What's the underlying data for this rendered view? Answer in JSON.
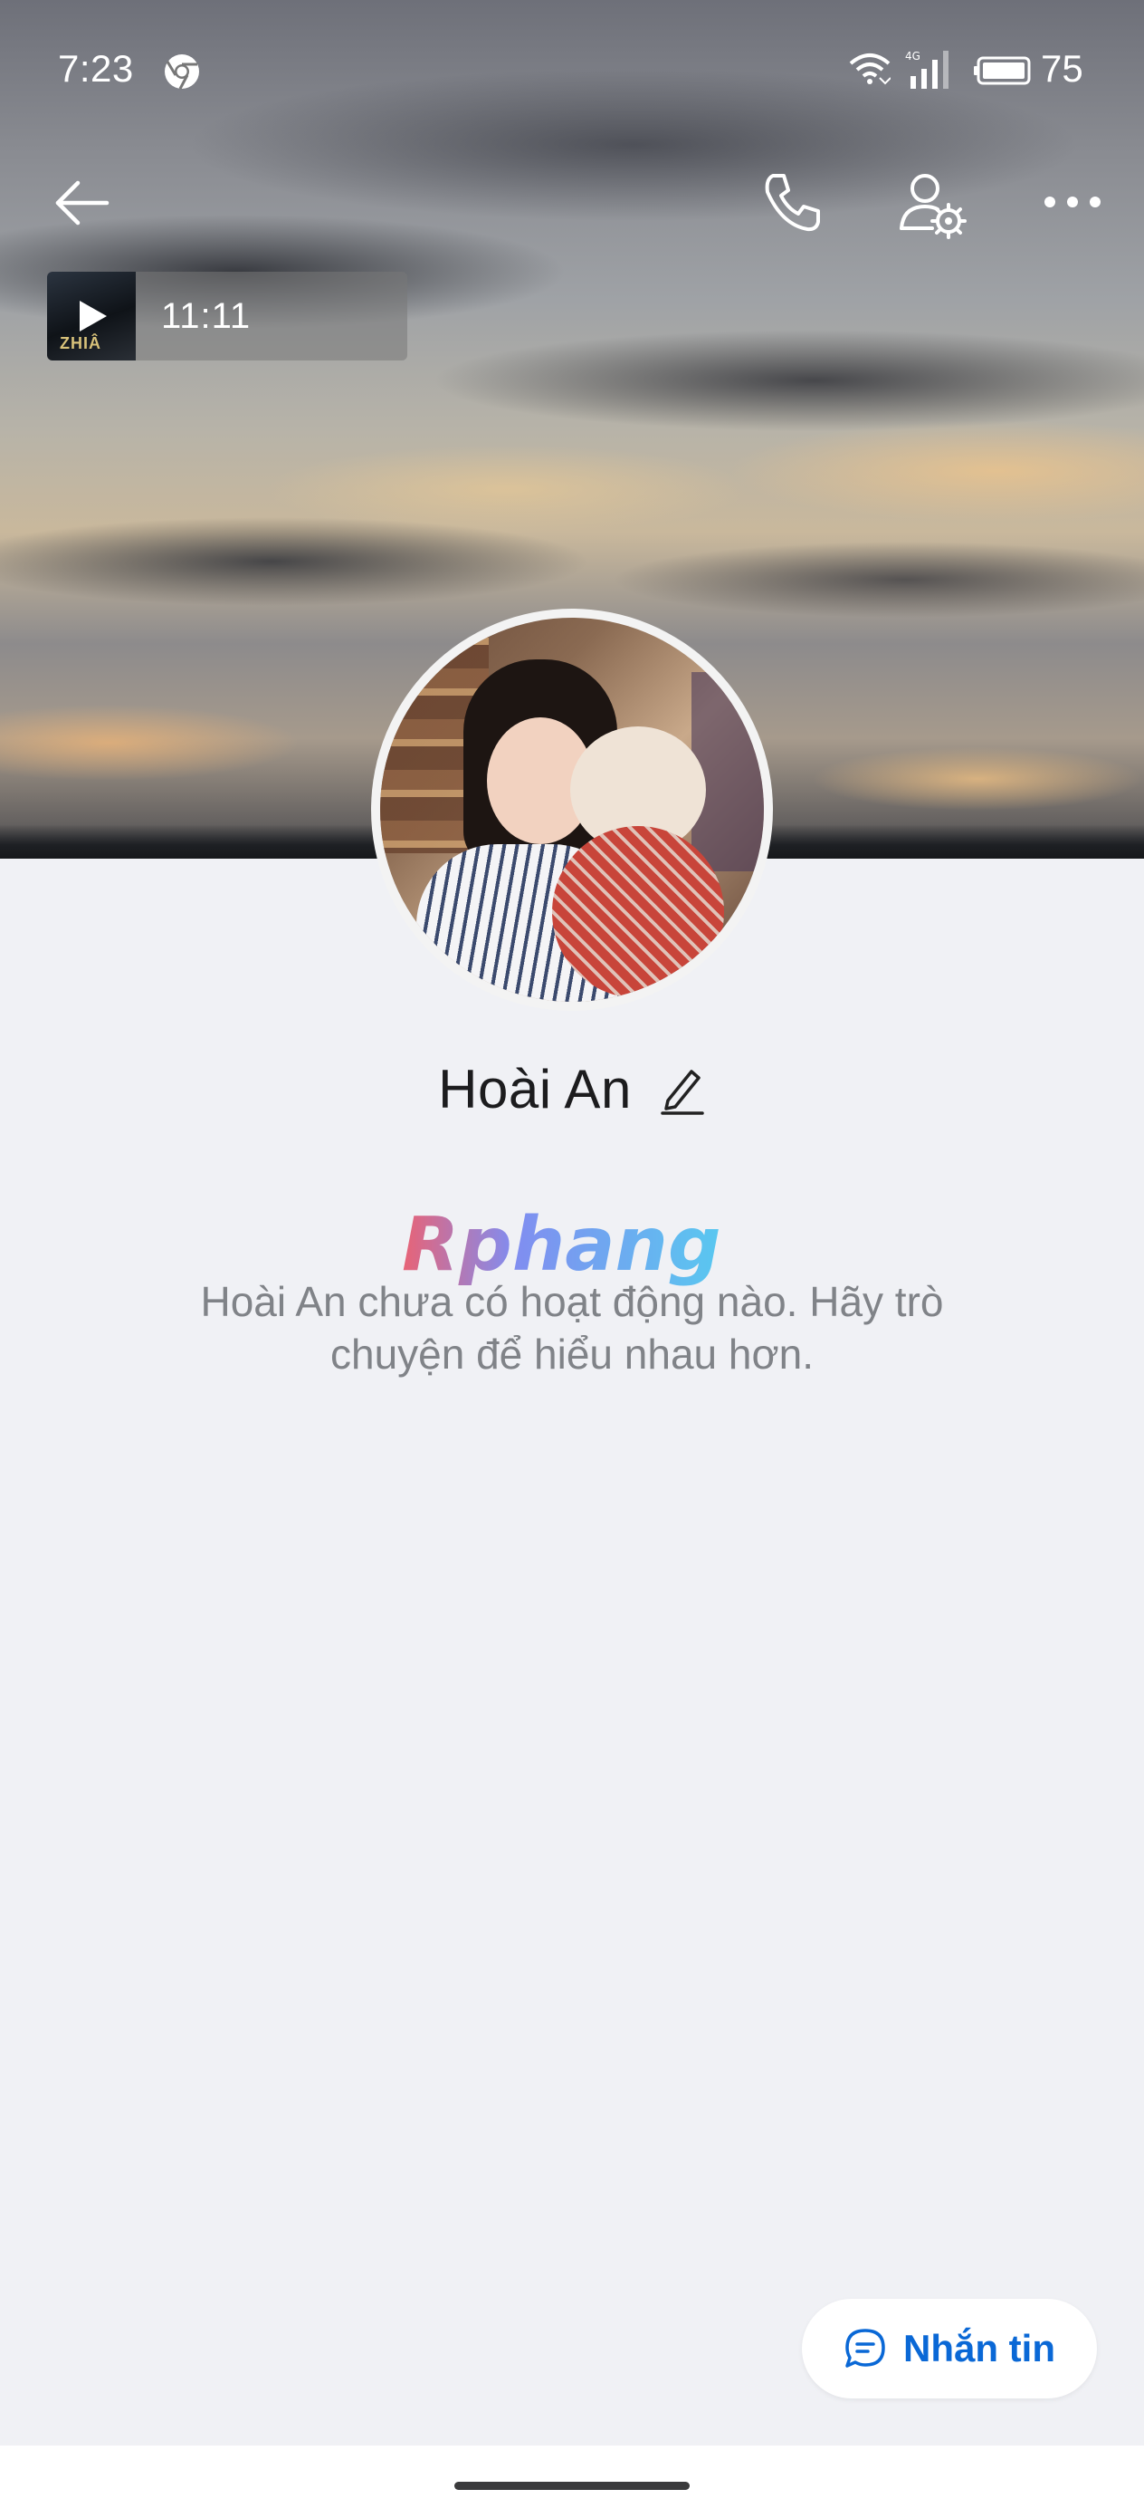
{
  "status_bar": {
    "time": "7:23",
    "battery": "75",
    "icons": [
      "chrome-icon",
      "wifi-icon",
      "signal-4g-icon",
      "battery-icon"
    ]
  },
  "header": {
    "actions": [
      "back-arrow-icon",
      "phone-call-icon",
      "user-settings-icon",
      "more-dots-icon"
    ]
  },
  "music": {
    "duration": "11:11",
    "thumbnail_text": "ZHIÂ"
  },
  "profile": {
    "name": "Hoài An",
    "empty_activity_text": "Hoài An chưa có hoạt động nào. Hãy trò chuyện để hiểu nhau hơn."
  },
  "watermark": {
    "text": "Rphang"
  },
  "message_button": {
    "label": "Nhắn tin"
  },
  "colors": {
    "accent": "#0a68d6",
    "background": "#f0f1f5",
    "muted_text": "#808388"
  }
}
